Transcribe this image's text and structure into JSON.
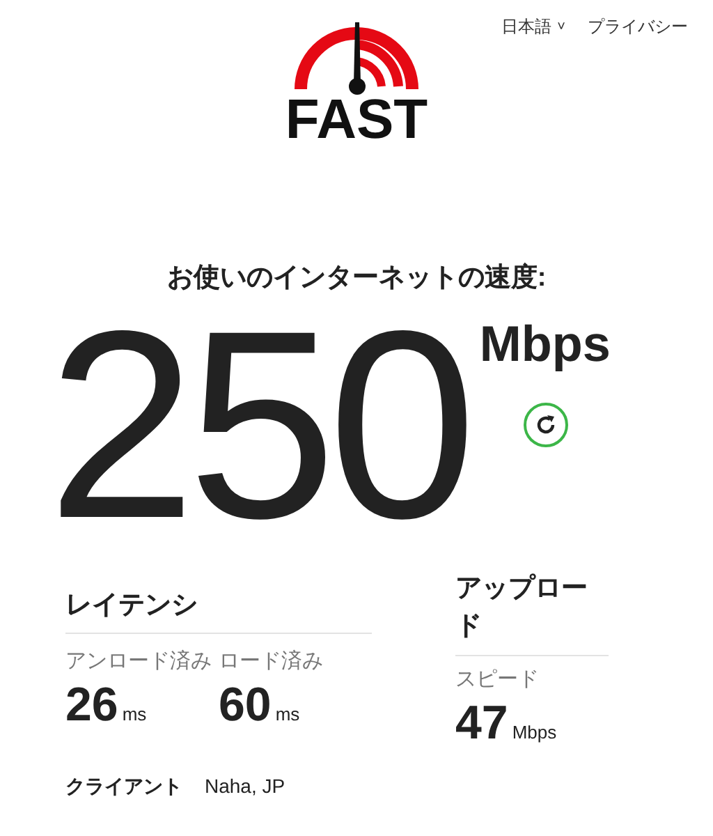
{
  "header": {
    "language": "日本語",
    "language_caret": "˅",
    "privacy_link": "プライバシー"
  },
  "logo": {
    "text": "FAST"
  },
  "heading": "お使いのインターネットの速度:",
  "speed": {
    "value": "250",
    "unit": "Mbps"
  },
  "latency": {
    "title": "レイテンシ",
    "items": [
      {
        "label": "アンロード済み",
        "value": "26",
        "unit": "ms"
      },
      {
        "label": "ロード済み",
        "value": "60",
        "unit": "ms"
      }
    ]
  },
  "upload": {
    "title": "アップロード",
    "label": "スピード",
    "value": "47",
    "unit": "Mbps"
  },
  "client": {
    "label": "クライアント",
    "value": "Naha, JP"
  }
}
